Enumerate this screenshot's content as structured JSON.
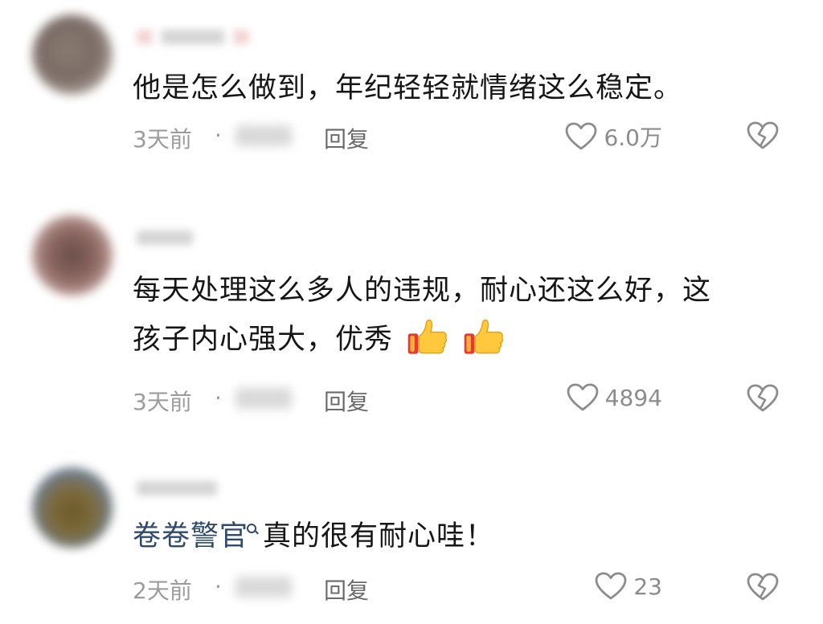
{
  "comments": [
    {
      "text": "他是怎么做到，年纪轻轻就情绪这么稳定。",
      "time": "3天前",
      "separator": "·",
      "reply_label": "回复",
      "likes": "6.0万"
    },
    {
      "text_line1": "每天处理这么多人的违规，耐心还这么好，这",
      "text_line2": "孩子内心强大，优秀",
      "emoji": [
        "thumbs-up",
        "thumbs-up"
      ],
      "time": "3天前",
      "separator": "·",
      "reply_label": "回复",
      "likes": "4894"
    },
    {
      "mention": "卷卷警官",
      "text": "真的很有耐心哇！",
      "time": "2天前",
      "separator": "·",
      "reply_label": "回复",
      "likes": "23"
    }
  ],
  "colors": {
    "mention": "#2f4a6e",
    "meta": "#9c9c9c",
    "text": "#161616"
  },
  "icons": {
    "like": "heart-outline-icon",
    "dislike": "broken-heart-icon",
    "mention_marker": "search-icon"
  }
}
